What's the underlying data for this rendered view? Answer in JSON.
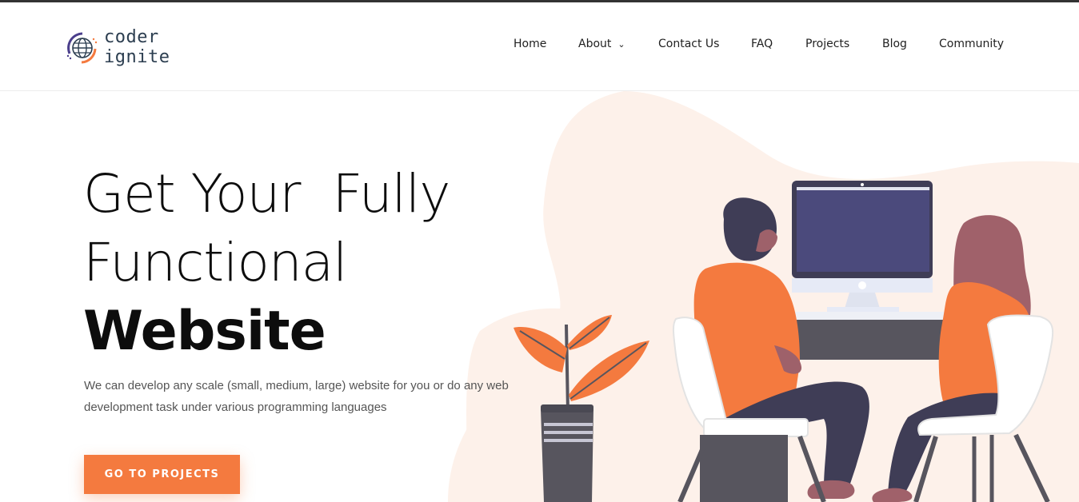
{
  "brand": {
    "line1": "coder",
    "line2": "ignite"
  },
  "nav": {
    "items": [
      {
        "label": "Home"
      },
      {
        "label": "About"
      },
      {
        "label": "Contact Us"
      },
      {
        "label": "FAQ"
      },
      {
        "label": "Projects"
      },
      {
        "label": "Blog"
      },
      {
        "label": "Community"
      }
    ],
    "about_has_dropdown": true
  },
  "hero": {
    "headline_line1": "Get Your  Fully",
    "headline_line2": "Functional",
    "headline_line3": "Website",
    "description": "We can develop any scale (small, medium, large) website for you or do any web development task under various programming languages",
    "cta_label": "GO TO PROJECTS"
  },
  "icons": {
    "logo": "globe-icon",
    "dropdown": "chevron-down-icon"
  },
  "colors": {
    "accent": "#f47a3f",
    "blob": "#fdf1ea",
    "monitor": "#4b4a7c",
    "text_dark": "#0d0d0d",
    "text_muted": "#555555"
  }
}
